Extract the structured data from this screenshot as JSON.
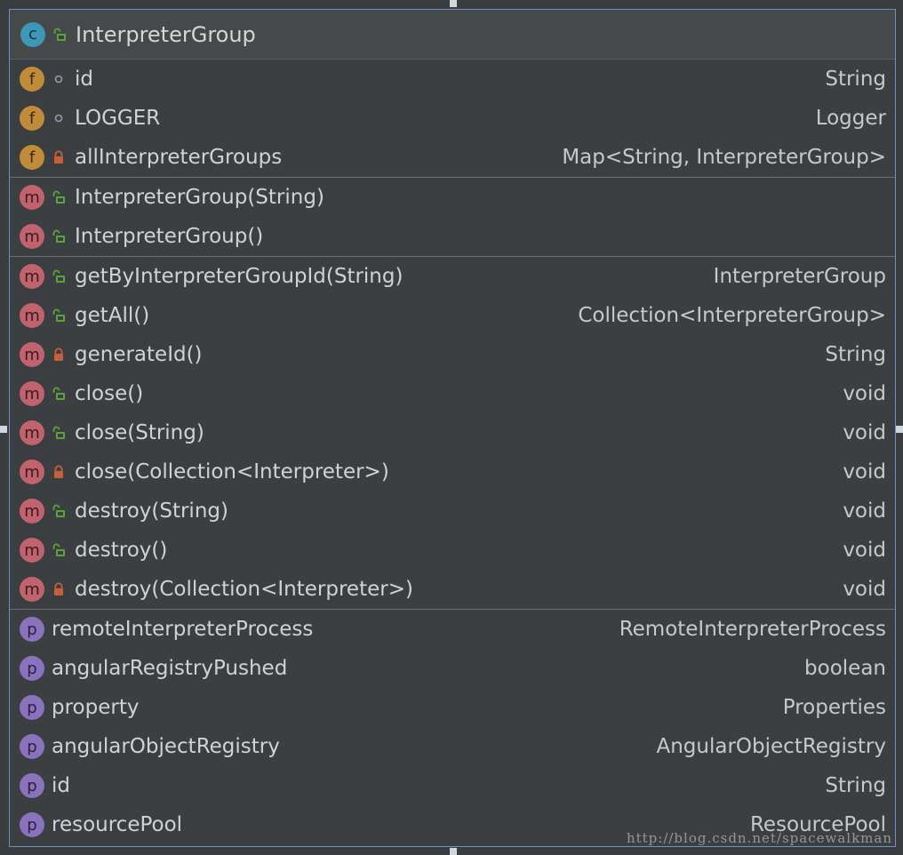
{
  "class": {
    "kind": "c",
    "name": "InterpreterGroup"
  },
  "fields": [
    {
      "badge": "f",
      "visibility": "package",
      "name": "id",
      "type": "String",
      "static": false,
      "final": false
    },
    {
      "badge": "f",
      "visibility": "package",
      "name": "LOGGER",
      "type": "Logger",
      "static": false,
      "final": false
    },
    {
      "badge": "f",
      "visibility": "private",
      "name": "allInterpreterGroups",
      "type": "Map<String, InterpreterGroup>",
      "static": true,
      "final": true
    }
  ],
  "constructors": [
    {
      "badge": "m",
      "visibility": "public",
      "name": "InterpreterGroup(String)",
      "type": ""
    },
    {
      "badge": "m",
      "visibility": "public",
      "name": "InterpreterGroup()",
      "type": ""
    }
  ],
  "methods": [
    {
      "badge": "m",
      "visibility": "public",
      "name": "getByInterpreterGroupId(String)",
      "type": "InterpreterGroup",
      "static": true
    },
    {
      "badge": "m",
      "visibility": "public",
      "name": "getAll()",
      "type": "Collection<InterpreterGroup>",
      "static": true
    },
    {
      "badge": "m",
      "visibility": "private",
      "name": "generateId()",
      "type": "String",
      "static": true
    },
    {
      "badge": "m",
      "visibility": "public",
      "name": "close()",
      "type": "void",
      "static": false
    },
    {
      "badge": "m",
      "visibility": "public",
      "name": "close(String)",
      "type": "void",
      "static": false
    },
    {
      "badge": "m",
      "visibility": "private",
      "name": "close(Collection<Interpreter>)",
      "type": "void",
      "static": false
    },
    {
      "badge": "m",
      "visibility": "public",
      "name": "destroy(String)",
      "type": "void",
      "static": false
    },
    {
      "badge": "m",
      "visibility": "public",
      "name": "destroy()",
      "type": "void",
      "static": false
    },
    {
      "badge": "m",
      "visibility": "private",
      "name": "destroy(Collection<Interpreter>)",
      "type": "void",
      "static": false
    }
  ],
  "properties": [
    {
      "badge": "p",
      "name": "remoteInterpreterProcess",
      "type": "RemoteInterpreterProcess",
      "accessors": "get-set"
    },
    {
      "badge": "p",
      "name": "angularRegistryPushed",
      "type": "boolean",
      "accessors": "get-set"
    },
    {
      "badge": "p",
      "name": "property",
      "type": "Properties",
      "accessors": "get"
    },
    {
      "badge": "p",
      "name": "angularObjectRegistry",
      "type": "AngularObjectRegistry",
      "accessors": "get-set"
    },
    {
      "badge": "p",
      "name": "id",
      "type": "String",
      "accessors": "get"
    },
    {
      "badge": "p",
      "name": "resourcePool",
      "type": "ResourcePool",
      "accessors": "get-set"
    }
  ],
  "watermark": "http://blog.csdn.net/spacewalkman",
  "colors": {
    "public": "#5ba33b",
    "private": "#c75f38",
    "package": "#9a9a9a",
    "border": "#6f8fc5"
  }
}
